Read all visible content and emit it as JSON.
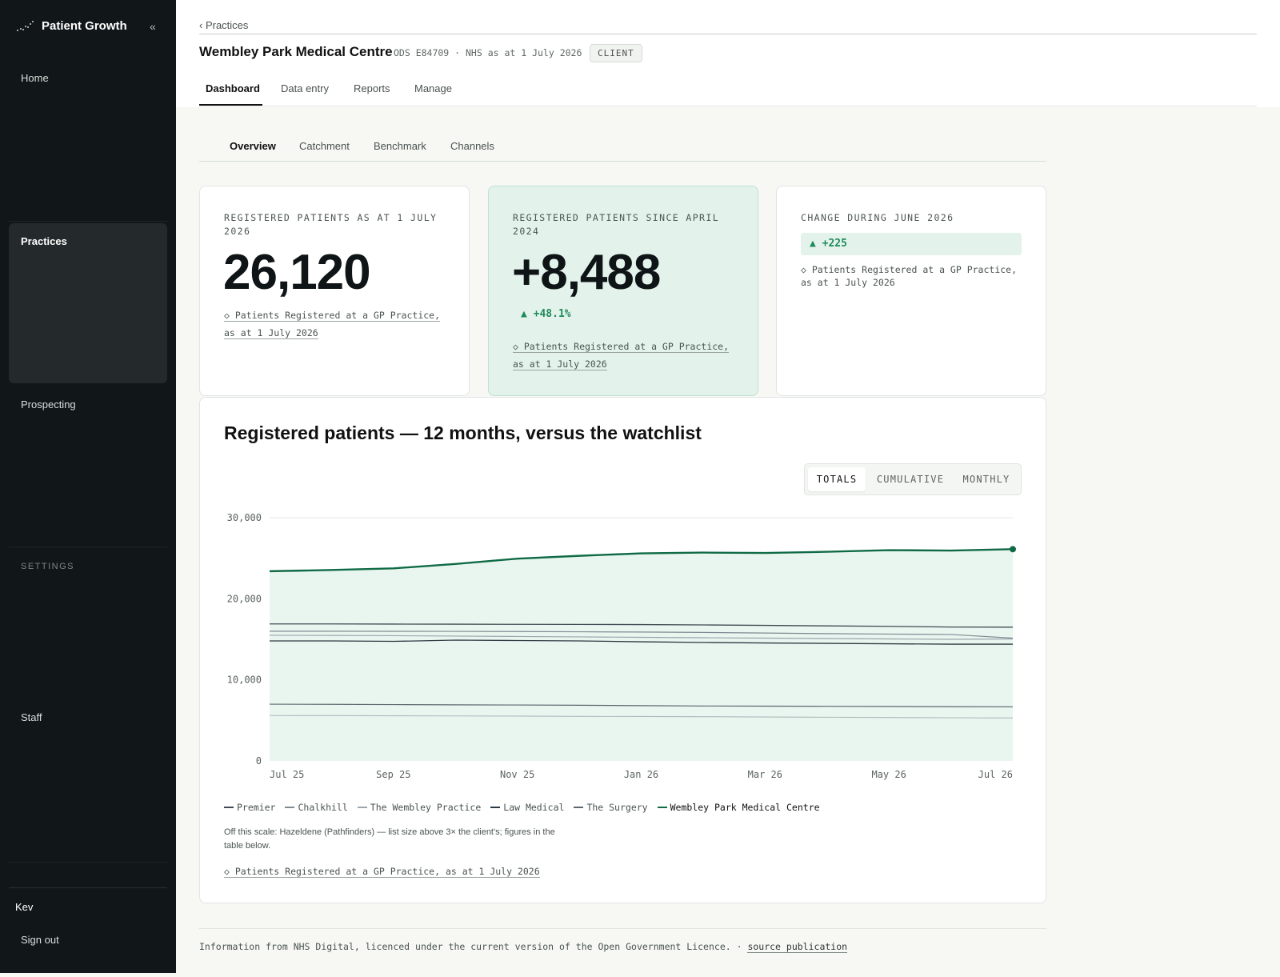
{
  "sidebar": {
    "brand": "Patient Growth",
    "brand_icon": "growth-dots-icon",
    "collapse_label": "«",
    "items": {
      "home": "Home",
      "practices": "Practices",
      "prospecting": "Prospecting",
      "staff": "Staff"
    },
    "settings_header": "SETTINGS",
    "user": "Kev",
    "sign_out": "Sign out"
  },
  "header": {
    "breadcrumb": "‹ Practices",
    "title": "Wembley Park Medical Centre",
    "meta": "ODS E84709 · NHS as at 1 July 2026",
    "badge": "CLIENT",
    "tabs": [
      "Dashboard",
      "Data entry",
      "Reports",
      "Manage"
    ],
    "active_tab": "Dashboard"
  },
  "subtabs": [
    "Overview",
    "Catchment",
    "Benchmark",
    "Channels"
  ],
  "cards": {
    "registered": {
      "label": "REGISTERED PATIENTS AS AT 1 JULY 2026",
      "value": "26,120",
      "note": "◇ Patients Registered at a GP Practice, as at 1 July 2026"
    },
    "since": {
      "label": "REGISTERED PATIENTS SINCE APRIL 2024",
      "value": "+8,488",
      "delta": "▲ +48.1%",
      "note": "◇ Patients Registered at a GP Practice, as at 1 July 2026"
    },
    "change": {
      "label": "CHANGE DURING JUNE 2026",
      "delta": "▲ +225",
      "note": "◇ Patients Registered at a GP Practice, as at 1 July 2026"
    }
  },
  "chart_section": {
    "title": "Registered patients — 12 months, versus the watchlist",
    "toggle": [
      "TOTALS",
      "CUMULATIVE",
      "MONTHLY"
    ],
    "active_toggle": "TOTALS",
    "offscale": "Off this scale: Hazeldene (Pathfinders) — list size above 3× the client's; figures in the table below.",
    "note": "◇ Patients Registered at a GP Practice, as at 1 July 2026"
  },
  "chart_data": {
    "type": "line",
    "x": [
      "Jul 25",
      "Aug 25",
      "Sep 25",
      "Oct 25",
      "Nov 25",
      "Dec 25",
      "Jan 26",
      "Feb 26",
      "Mar 26",
      "Apr 26",
      "May 26",
      "Jun 26",
      "Jul 26"
    ],
    "x_tick_labels": [
      "Jul 25",
      "Sep 25",
      "Nov 25",
      "Jan 26",
      "Mar 26",
      "May 26",
      "Jul 26"
    ],
    "y_ticks": [
      "0",
      "10,000",
      "20,000",
      "30,000"
    ],
    "ylim": [
      0,
      30000
    ],
    "grid": "horizontal",
    "legend": "bottom-left",
    "series": [
      {
        "name": "Premier",
        "color": "#3f4a52",
        "width": 1.3,
        "values": [
          16900,
          16900,
          16880,
          16870,
          16850,
          16840,
          16820,
          16780,
          16720,
          16660,
          16600,
          16520,
          16500
        ]
      },
      {
        "name": "Chalkhill",
        "color": "#7f8a90",
        "width": 1.2,
        "values": [
          16000,
          16000,
          15990,
          15980,
          15960,
          15930,
          15900,
          15850,
          15780,
          15700,
          15650,
          15600,
          15150
        ]
      },
      {
        "name": "The Wembley Practice",
        "color": "#9aa6ab",
        "width": 1.2,
        "values": [
          15500,
          15480,
          15450,
          15400,
          15350,
          15300,
          15250,
          15200,
          15150,
          15100,
          15050,
          15000,
          15050
        ]
      },
      {
        "name": "Law Medical",
        "color": "#2b3a42",
        "width": 1.3,
        "values": [
          14800,
          14800,
          14750,
          14900,
          14850,
          14800,
          14700,
          14620,
          14550,
          14500,
          14450,
          14400,
          14400
        ]
      },
      {
        "name": "The Surgery",
        "color": "#5c676d",
        "width": 1.2,
        "values": [
          7000,
          6980,
          6950,
          6920,
          6900,
          6870,
          6820,
          6780,
          6760,
          6740,
          6720,
          6700,
          6680
        ]
      },
      {
        "name": "",
        "color": "#aeb9bd",
        "width": 1.1,
        "values": [
          5600,
          5590,
          5570,
          5550,
          5530,
          5500,
          5480,
          5460,
          5420,
          5390,
          5360,
          5330,
          5300
        ]
      },
      {
        "name": "Wembley Park Medical Centre",
        "color": "#0f6b45",
        "width": 2.4,
        "values": [
          23400,
          23550,
          23750,
          24300,
          24950,
          25300,
          25600,
          25700,
          25650,
          25800,
          26000,
          25950,
          26120
        ]
      }
    ],
    "area_fill": "#e9f5ef"
  },
  "footer": {
    "text": "Information from NHS Digital, licenced under the current version of the Open Government Licence. · ",
    "link": "source publication"
  }
}
